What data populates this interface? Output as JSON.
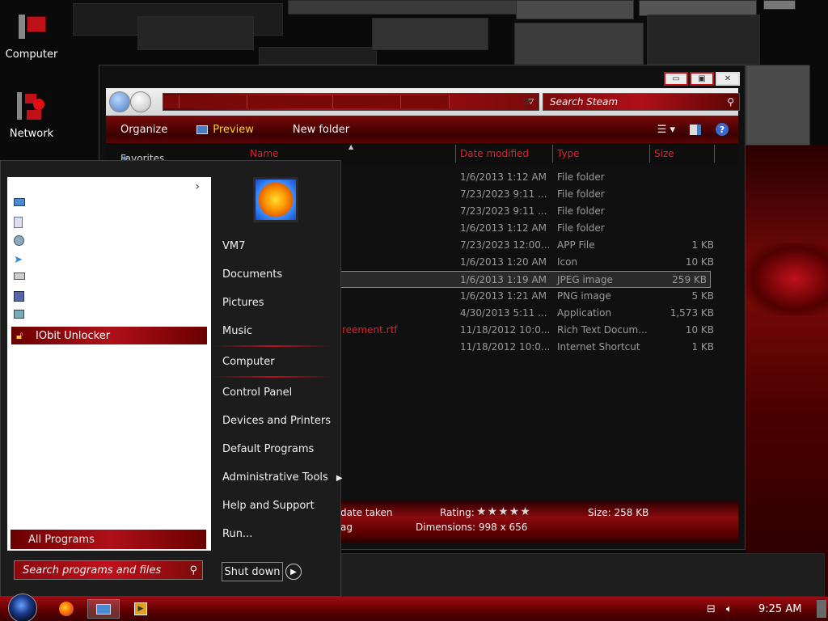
{
  "desktop": {
    "icons": [
      {
        "label": "Computer",
        "icon": "computer-icon"
      },
      {
        "label": "Network",
        "icon": "network-icon"
      }
    ]
  },
  "explorer": {
    "search_placeholder": "Search Steam",
    "toolbar": {
      "organize": "Organize",
      "preview": "Preview",
      "new_folder": "New folder"
    },
    "nav_favorites": "Favorites",
    "columns": {
      "name": "Name",
      "date": "Date modified",
      "type": "Type",
      "size": "Size"
    },
    "rows": [
      {
        "name": "",
        "date": "1/6/2013 1:12 AM",
        "type": "File folder",
        "size": ""
      },
      {
        "name": "",
        "date": "7/23/2023 9:11 ...",
        "type": "File folder",
        "size": ""
      },
      {
        "name": "",
        "date": "7/23/2023 9:11 ...",
        "type": "File folder",
        "size": ""
      },
      {
        "name": "",
        "date": "1/6/2013 1:12 AM",
        "type": "File folder",
        "size": ""
      },
      {
        "name": "",
        "date": "7/23/2023 12:00...",
        "type": "APP File",
        "size": "1 KB"
      },
      {
        "name": "",
        "date": "1/6/2013 1:20 AM",
        "type": "Icon",
        "size": "10 KB"
      },
      {
        "name": "",
        "date": "1/6/2013 1:19 AM",
        "type": "JPEG image",
        "size": "259 KB",
        "selected": true
      },
      {
        "name": "",
        "date": "1/6/2013 1:21 AM",
        "type": "PNG image",
        "size": "5 KB"
      },
      {
        "name": "",
        "date": "4/30/2013 5:11 ...",
        "type": "Application",
        "size": "1,573 KB"
      },
      {
        "name": "reement.rtf",
        "date": "11/18/2012 10:0...",
        "type": "Rich Text Docum...",
        "size": "10 KB"
      },
      {
        "name": "",
        "date": "11/18/2012 10:0...",
        "type": "Internet Shortcut",
        "size": "1 KB"
      }
    ],
    "details": {
      "date_taken": "date taken",
      "rating_label": "Rating:",
      "stars": "★★★★★",
      "size": "Size: 258 KB",
      "tags": "ag",
      "dimensions": "Dimensions: 998 x 656"
    }
  },
  "start_menu": {
    "pinned_program": "IObit Unlocker",
    "all_programs": "All Programs",
    "search_placeholder": "Search programs and files",
    "right_items": [
      {
        "label": "VM7"
      },
      {
        "label": "Documents"
      },
      {
        "label": "Pictures"
      },
      {
        "label": "Music"
      },
      {
        "label": "Computer"
      },
      {
        "label": "Control Panel"
      },
      {
        "label": "Devices and Printers"
      },
      {
        "label": "Default Programs"
      },
      {
        "label": "Administrative Tools"
      },
      {
        "label": "Help and Support"
      },
      {
        "label": "Run..."
      }
    ],
    "shutdown": "Shut down"
  },
  "taskbar": {
    "clock": "9:25 AM",
    "apps": [
      "firefox-icon",
      "explorer-icon",
      "media-player-icon"
    ]
  },
  "colors": {
    "accent_red": "#c0101a",
    "column_red": "#e3202a",
    "preview_yellow": "#ffd800"
  }
}
